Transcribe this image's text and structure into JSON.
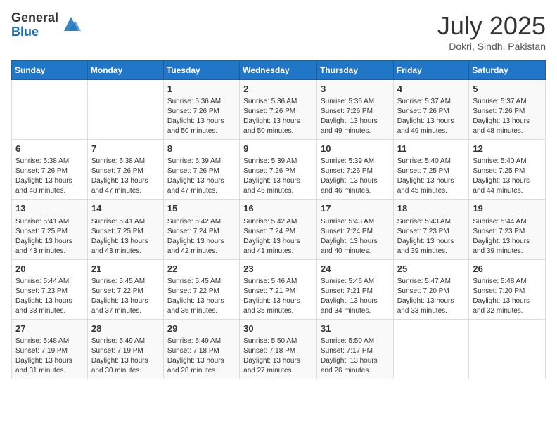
{
  "header": {
    "logo_general": "General",
    "logo_blue": "Blue",
    "month_title": "July 2025",
    "location": "Dokri, Sindh, Pakistan"
  },
  "weekdays": [
    "Sunday",
    "Monday",
    "Tuesday",
    "Wednesday",
    "Thursday",
    "Friday",
    "Saturday"
  ],
  "weeks": [
    [
      {
        "day": "",
        "sunrise": "",
        "sunset": "",
        "daylight": ""
      },
      {
        "day": "",
        "sunrise": "",
        "sunset": "",
        "daylight": ""
      },
      {
        "day": "1",
        "sunrise": "Sunrise: 5:36 AM",
        "sunset": "Sunset: 7:26 PM",
        "daylight": "Daylight: 13 hours and 50 minutes."
      },
      {
        "day": "2",
        "sunrise": "Sunrise: 5:36 AM",
        "sunset": "Sunset: 7:26 PM",
        "daylight": "Daylight: 13 hours and 50 minutes."
      },
      {
        "day": "3",
        "sunrise": "Sunrise: 5:36 AM",
        "sunset": "Sunset: 7:26 PM",
        "daylight": "Daylight: 13 hours and 49 minutes."
      },
      {
        "day": "4",
        "sunrise": "Sunrise: 5:37 AM",
        "sunset": "Sunset: 7:26 PM",
        "daylight": "Daylight: 13 hours and 49 minutes."
      },
      {
        "day": "5",
        "sunrise": "Sunrise: 5:37 AM",
        "sunset": "Sunset: 7:26 PM",
        "daylight": "Daylight: 13 hours and 48 minutes."
      }
    ],
    [
      {
        "day": "6",
        "sunrise": "Sunrise: 5:38 AM",
        "sunset": "Sunset: 7:26 PM",
        "daylight": "Daylight: 13 hours and 48 minutes."
      },
      {
        "day": "7",
        "sunrise": "Sunrise: 5:38 AM",
        "sunset": "Sunset: 7:26 PM",
        "daylight": "Daylight: 13 hours and 47 minutes."
      },
      {
        "day": "8",
        "sunrise": "Sunrise: 5:39 AM",
        "sunset": "Sunset: 7:26 PM",
        "daylight": "Daylight: 13 hours and 47 minutes."
      },
      {
        "day": "9",
        "sunrise": "Sunrise: 5:39 AM",
        "sunset": "Sunset: 7:26 PM",
        "daylight": "Daylight: 13 hours and 46 minutes."
      },
      {
        "day": "10",
        "sunrise": "Sunrise: 5:39 AM",
        "sunset": "Sunset: 7:26 PM",
        "daylight": "Daylight: 13 hours and 46 minutes."
      },
      {
        "day": "11",
        "sunrise": "Sunrise: 5:40 AM",
        "sunset": "Sunset: 7:25 PM",
        "daylight": "Daylight: 13 hours and 45 minutes."
      },
      {
        "day": "12",
        "sunrise": "Sunrise: 5:40 AM",
        "sunset": "Sunset: 7:25 PM",
        "daylight": "Daylight: 13 hours and 44 minutes."
      }
    ],
    [
      {
        "day": "13",
        "sunrise": "Sunrise: 5:41 AM",
        "sunset": "Sunset: 7:25 PM",
        "daylight": "Daylight: 13 hours and 43 minutes."
      },
      {
        "day": "14",
        "sunrise": "Sunrise: 5:41 AM",
        "sunset": "Sunset: 7:25 PM",
        "daylight": "Daylight: 13 hours and 43 minutes."
      },
      {
        "day": "15",
        "sunrise": "Sunrise: 5:42 AM",
        "sunset": "Sunset: 7:24 PM",
        "daylight": "Daylight: 13 hours and 42 minutes."
      },
      {
        "day": "16",
        "sunrise": "Sunrise: 5:42 AM",
        "sunset": "Sunset: 7:24 PM",
        "daylight": "Daylight: 13 hours and 41 minutes."
      },
      {
        "day": "17",
        "sunrise": "Sunrise: 5:43 AM",
        "sunset": "Sunset: 7:24 PM",
        "daylight": "Daylight: 13 hours and 40 minutes."
      },
      {
        "day": "18",
        "sunrise": "Sunrise: 5:43 AM",
        "sunset": "Sunset: 7:23 PM",
        "daylight": "Daylight: 13 hours and 39 minutes."
      },
      {
        "day": "19",
        "sunrise": "Sunrise: 5:44 AM",
        "sunset": "Sunset: 7:23 PM",
        "daylight": "Daylight: 13 hours and 39 minutes."
      }
    ],
    [
      {
        "day": "20",
        "sunrise": "Sunrise: 5:44 AM",
        "sunset": "Sunset: 7:23 PM",
        "daylight": "Daylight: 13 hours and 38 minutes."
      },
      {
        "day": "21",
        "sunrise": "Sunrise: 5:45 AM",
        "sunset": "Sunset: 7:22 PM",
        "daylight": "Daylight: 13 hours and 37 minutes."
      },
      {
        "day": "22",
        "sunrise": "Sunrise: 5:45 AM",
        "sunset": "Sunset: 7:22 PM",
        "daylight": "Daylight: 13 hours and 36 minutes."
      },
      {
        "day": "23",
        "sunrise": "Sunrise: 5:46 AM",
        "sunset": "Sunset: 7:21 PM",
        "daylight": "Daylight: 13 hours and 35 minutes."
      },
      {
        "day": "24",
        "sunrise": "Sunrise: 5:46 AM",
        "sunset": "Sunset: 7:21 PM",
        "daylight": "Daylight: 13 hours and 34 minutes."
      },
      {
        "day": "25",
        "sunrise": "Sunrise: 5:47 AM",
        "sunset": "Sunset: 7:20 PM",
        "daylight": "Daylight: 13 hours and 33 minutes."
      },
      {
        "day": "26",
        "sunrise": "Sunrise: 5:48 AM",
        "sunset": "Sunset: 7:20 PM",
        "daylight": "Daylight: 13 hours and 32 minutes."
      }
    ],
    [
      {
        "day": "27",
        "sunrise": "Sunrise: 5:48 AM",
        "sunset": "Sunset: 7:19 PM",
        "daylight": "Daylight: 13 hours and 31 minutes."
      },
      {
        "day": "28",
        "sunrise": "Sunrise: 5:49 AM",
        "sunset": "Sunset: 7:19 PM",
        "daylight": "Daylight: 13 hours and 30 minutes."
      },
      {
        "day": "29",
        "sunrise": "Sunrise: 5:49 AM",
        "sunset": "Sunset: 7:18 PM",
        "daylight": "Daylight: 13 hours and 28 minutes."
      },
      {
        "day": "30",
        "sunrise": "Sunrise: 5:50 AM",
        "sunset": "Sunset: 7:18 PM",
        "daylight": "Daylight: 13 hours and 27 minutes."
      },
      {
        "day": "31",
        "sunrise": "Sunrise: 5:50 AM",
        "sunset": "Sunset: 7:17 PM",
        "daylight": "Daylight: 13 hours and 26 minutes."
      },
      {
        "day": "",
        "sunrise": "",
        "sunset": "",
        "daylight": ""
      },
      {
        "day": "",
        "sunrise": "",
        "sunset": "",
        "daylight": ""
      }
    ]
  ]
}
